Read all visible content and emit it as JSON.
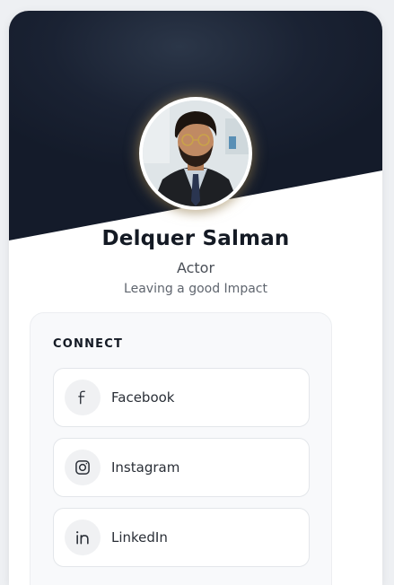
{
  "profile": {
    "name": "Delquer Salman",
    "role": "Actor",
    "tagline": "Leaving a good Impact"
  },
  "connect": {
    "title": "CONNECT",
    "links": [
      {
        "label": "Facebook",
        "icon": "facebook-icon"
      },
      {
        "label": "Instagram",
        "icon": "instagram-icon"
      },
      {
        "label": "LinkedIn",
        "icon": "linkedin-icon"
      }
    ]
  },
  "colors": {
    "hero_dark": "#1a2233",
    "text_dark": "#141a24",
    "card_bg": "#ffffff"
  }
}
